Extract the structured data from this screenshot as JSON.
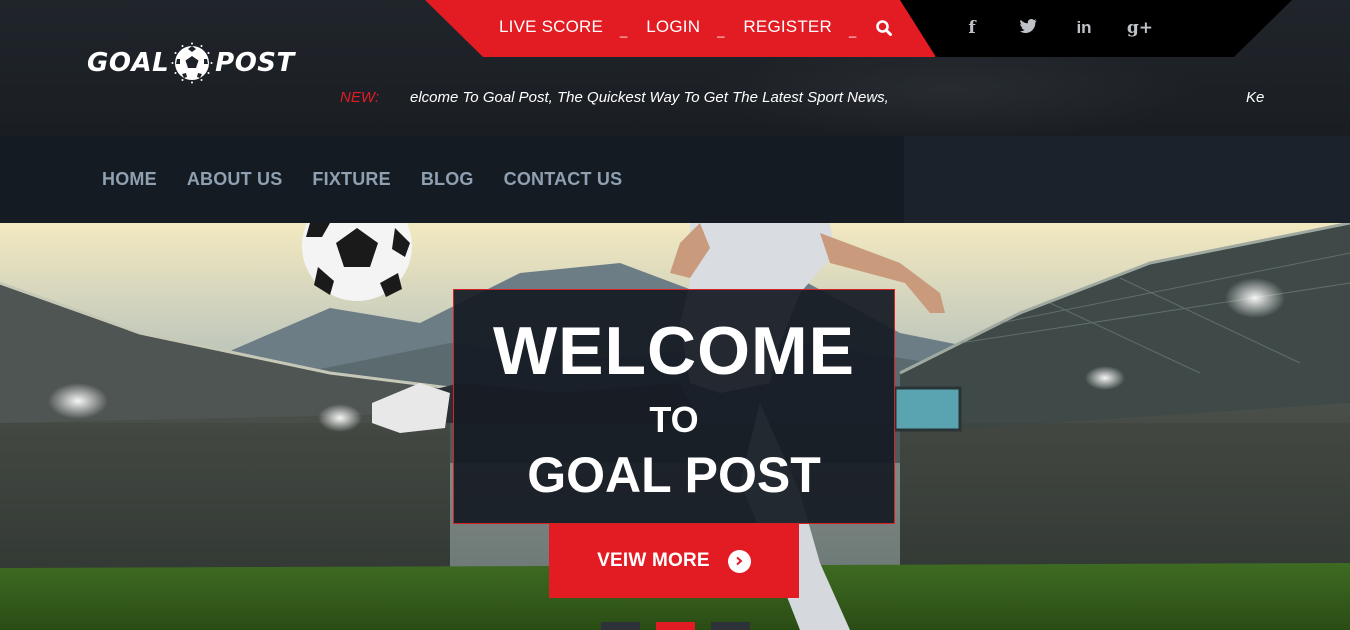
{
  "brand": {
    "logo_left": "GOAL",
    "logo_right": "POST"
  },
  "top_links": {
    "live_score": "LIVE SCORE",
    "login": "LOGIN",
    "register": "REGISTER",
    "separator": "_"
  },
  "social": {
    "facebook": "f",
    "twitter": "t",
    "linkedin": "in",
    "googleplus": "g+"
  },
  "ticker": {
    "label": "NEW:",
    "message": "elcome To Goal Post, The Quickest Way To Get The Latest Sport News,",
    "message_tail": "Ke"
  },
  "nav": {
    "items": [
      "HOME",
      "ABOUT US",
      "FIXTURE",
      "BLOG",
      "CONTACT US"
    ]
  },
  "hero": {
    "line1": "WELCOME",
    "line2": "TO",
    "line3": "GOAL POST",
    "button_label": "VEIW MORE",
    "slides": 3,
    "active_slide": 2
  },
  "colors": {
    "accent": "#e31b23",
    "header_bg": "#1d2228",
    "nav_bg": "#151b23",
    "nav_text": "#8fa0b2",
    "black_bar": "#000000"
  },
  "icons": [
    "soccer-ball-icon",
    "search-icon",
    "facebook-icon",
    "twitter-icon",
    "linkedin-icon",
    "googleplus-icon",
    "arrow-right-icon"
  ]
}
